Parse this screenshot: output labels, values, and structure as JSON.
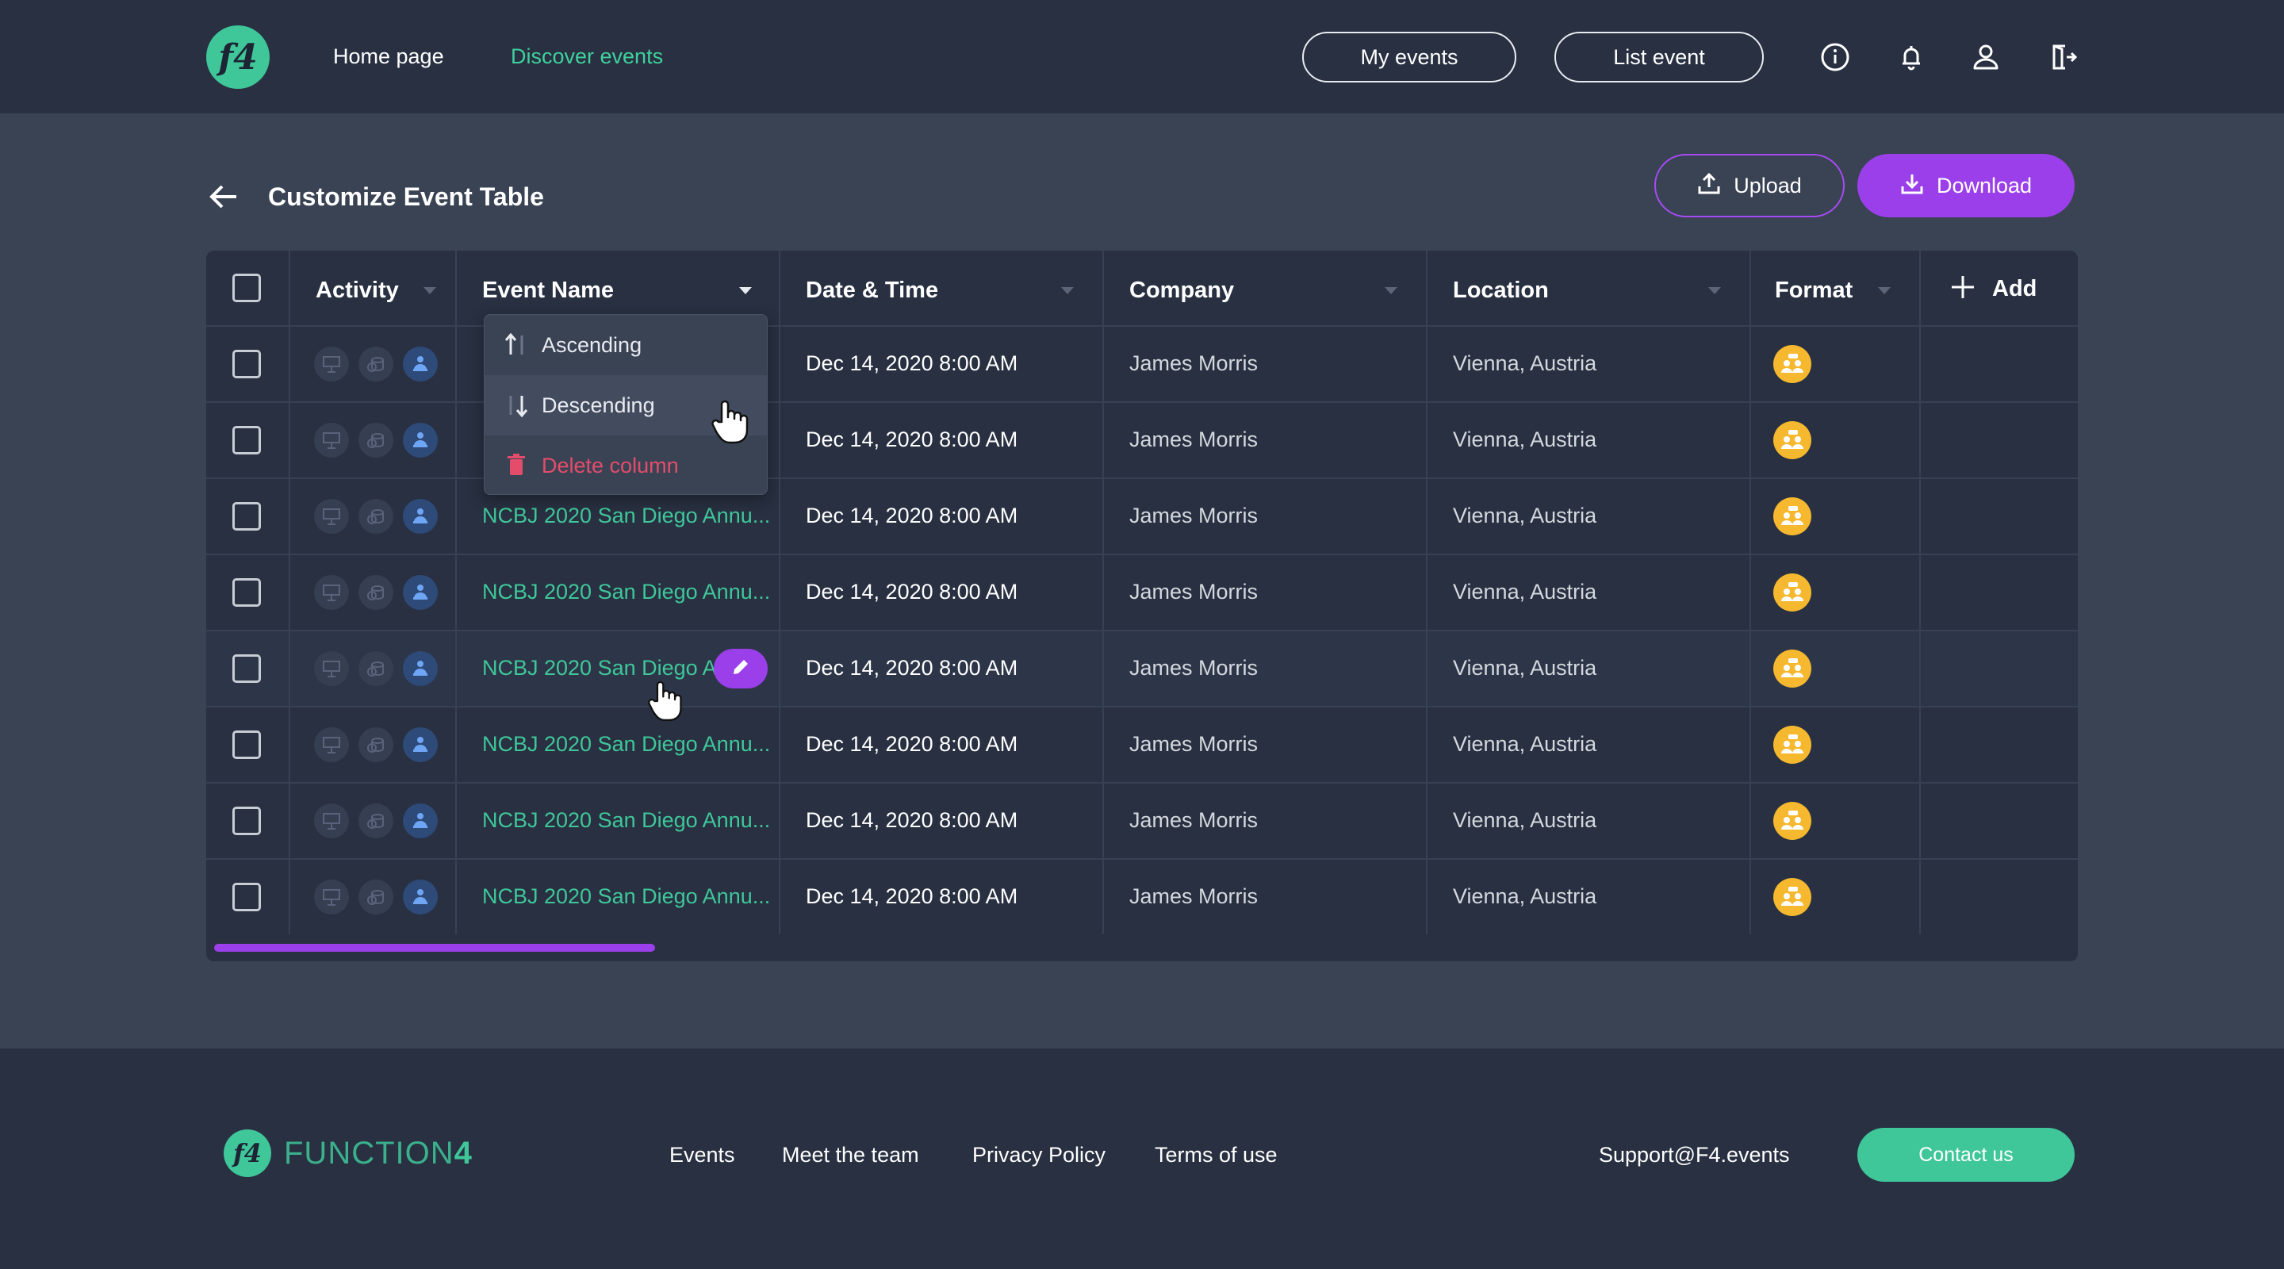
{
  "header": {
    "logo_text": "f4",
    "nav": [
      {
        "label": "Home page",
        "active": false
      },
      {
        "label": "Discover events",
        "active": true
      }
    ],
    "my_events_label": "My events",
    "list_event_label": "List event",
    "icons": [
      "info-icon",
      "bell-icon",
      "user-icon",
      "logout-icon"
    ]
  },
  "page": {
    "title": "Customize Event Table",
    "upload_label": "Upload",
    "download_label": "Download"
  },
  "table": {
    "columns": [
      "Activity",
      "Event Name",
      "Date & Time",
      "Company",
      "Location",
      "Format"
    ],
    "add_label": "Add",
    "rows": [
      {
        "event_name": "",
        "date": "Dec 14, 2020  8:00 AM",
        "company": "James Morris",
        "location": "Vienna, Austria"
      },
      {
        "event_name": "",
        "date": "Dec 14, 2020  8:00 AM",
        "company": "James Morris",
        "location": "Vienna, Austria"
      },
      {
        "event_name": "NCBJ 2020 San Diego Annu...",
        "date": "Dec 14, 2020  8:00 AM",
        "company": "James Morris",
        "location": "Vienna, Austria"
      },
      {
        "event_name": "NCBJ 2020 San Diego Annu...",
        "date": "Dec 14, 2020  8:00 AM",
        "company": "James Morris",
        "location": "Vienna, Austria"
      },
      {
        "event_name": "NCBJ 2020 San Diego An",
        "date": "Dec 14, 2020  8:00 AM",
        "company": "James Morris",
        "location": "Vienna, Austria"
      },
      {
        "event_name": "NCBJ 2020 San Diego Annu...",
        "date": "Dec 14, 2020  8:00 AM",
        "company": "James Morris",
        "location": "Vienna, Austria"
      },
      {
        "event_name": "NCBJ 2020 San Diego Annu...",
        "date": "Dec 14, 2020  8:00 AM",
        "company": "James Morris",
        "location": "Vienna, Austria"
      },
      {
        "event_name": "NCBJ 2020 San Diego Annu...",
        "date": "Dec 14, 2020  8:00 AM",
        "company": "James Morris",
        "location": "Vienna, Austria"
      }
    ],
    "sort_menu": {
      "ascending": "Ascending",
      "descending": "Descending",
      "delete": "Delete column"
    }
  },
  "footer": {
    "logo_text": "f4",
    "brand_part1": "FUNCTION",
    "brand_part2": "4",
    "links": [
      "Events",
      "Meet the team",
      "Privacy Policy",
      "Terms of use"
    ],
    "support_email": "Support@F4.events",
    "contact_label": "Contact us"
  },
  "colors": {
    "accent_green": "#3fc79a",
    "accent_purple": "#9a3fea",
    "format_yellow": "#f5b82e",
    "danger": "#e34d6b"
  }
}
